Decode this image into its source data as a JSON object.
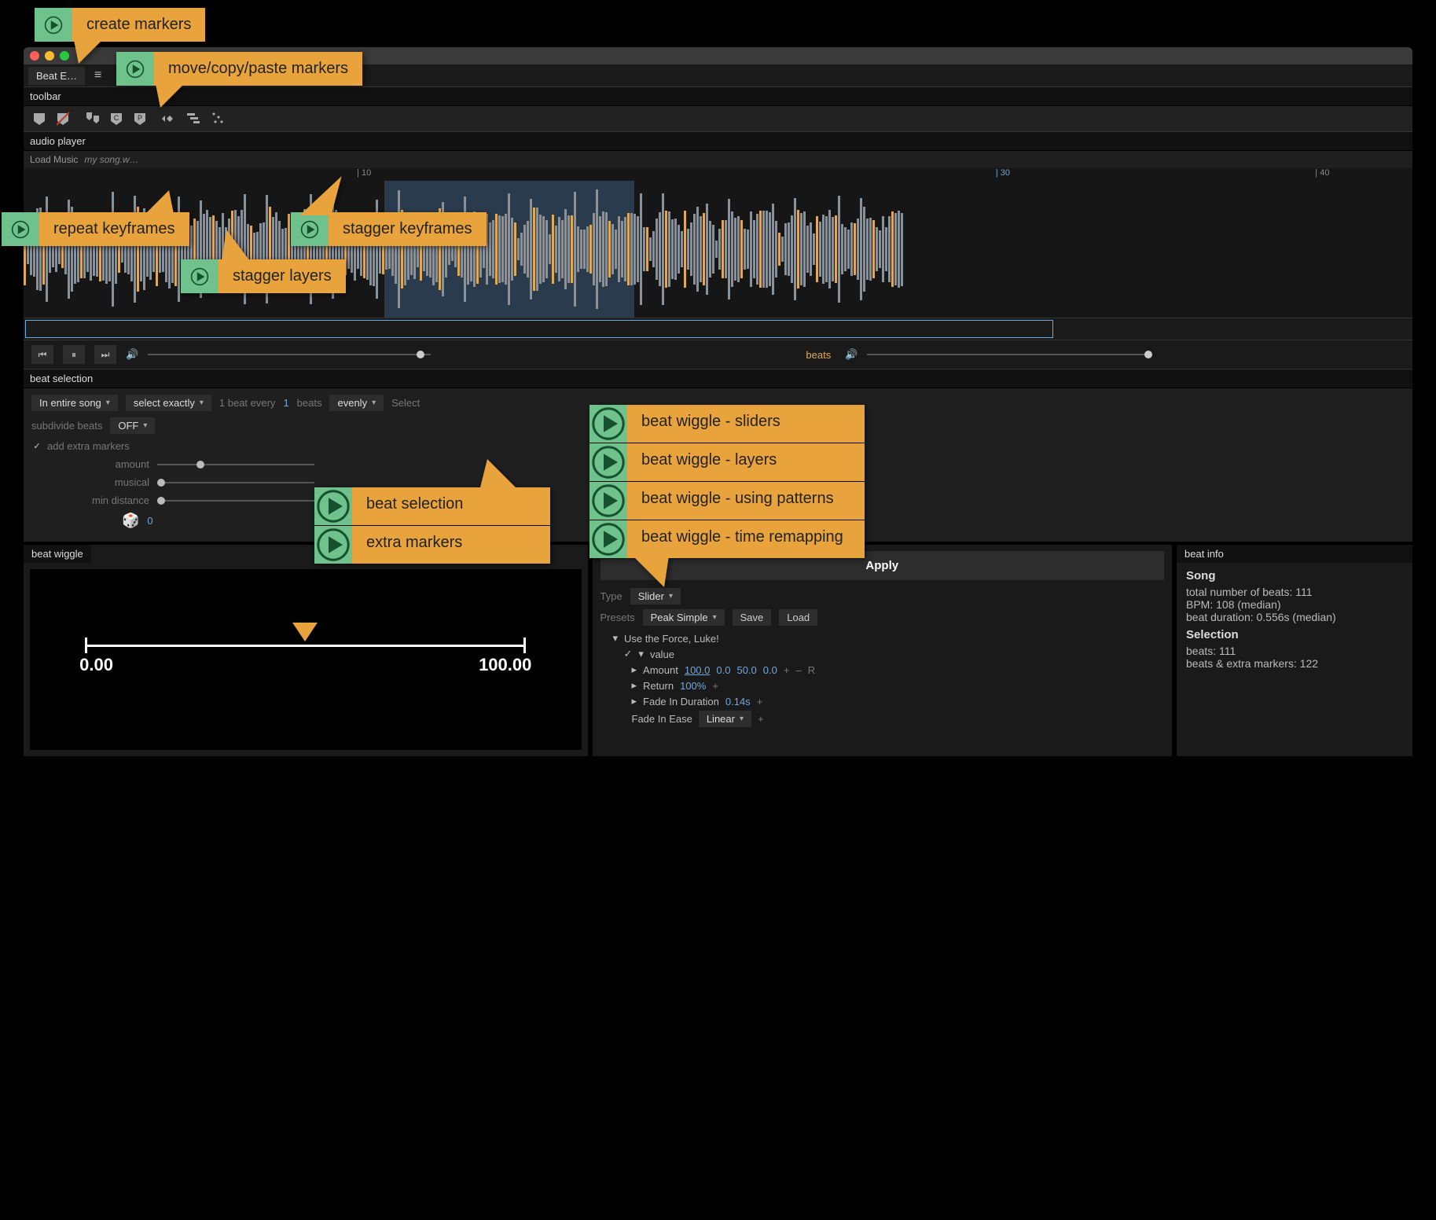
{
  "callouts": {
    "create_markers": "create markers",
    "move_copy_paste": "move/copy/paste markers",
    "repeat_keyframes": "repeat keyframes",
    "stagger_layers": "stagger layers",
    "stagger_keyframes": "stagger keyframes",
    "beat_selection": "beat selection",
    "extra_markers": "extra markers",
    "bw_sliders": "beat wiggle - sliders",
    "bw_layers": "beat wiggle - layers",
    "bw_patterns": "beat wiggle - using patterns",
    "bw_time": "beat wiggle - time remapping"
  },
  "window": {
    "tab_title": "Beat E…"
  },
  "sections": {
    "toolbar": "toolbar",
    "audio_player": "audio player",
    "beat_selection": "beat selection",
    "beat_wiggle": "beat wiggle",
    "beat_info": "beat info"
  },
  "audio": {
    "load_label": "Load Music",
    "filename": "my song.w…",
    "ruler": {
      "t10": "| 10",
      "t30": "| 30",
      "t40": "| 40"
    }
  },
  "transport": {
    "beats_label": "beats"
  },
  "beat_selection": {
    "scope": "In entire song",
    "select_mode": "select exactly",
    "every_prefix": "1 beat every",
    "every_value": "1",
    "every_suffix": "beats",
    "dist": "evenly",
    "select_btn": "Select",
    "subdivide_label": "subdivide beats",
    "subdivide_value": "OFF",
    "add_extra": "add extra markers",
    "amount": "amount",
    "musical": "musical",
    "min_distance": "min distance",
    "random_value": "0"
  },
  "wiggle_preview": {
    "min": "0.00",
    "max": "100.00"
  },
  "apply": {
    "apply_btn": "Apply",
    "type_label": "Type",
    "type_value": "Slider",
    "presets_label": "Presets",
    "preset_value": "Peak Simple",
    "save": "Save",
    "load": "Load",
    "force": "Use the Force, Luke!",
    "value_label": "value",
    "amount_label": "Amount",
    "amount_v1": "100.0",
    "amount_v2": "0.0",
    "amount_v3": "50.0",
    "amount_v4": "0.0",
    "plus": "+",
    "minus": "–",
    "reset": "R",
    "return_label": "Return",
    "return_value": "100%",
    "fadein_label": "Fade In Duration",
    "fadein_value": "0.14s",
    "fadein_ease_label": "Fade In Ease",
    "fadein_ease_value": "Linear"
  },
  "info": {
    "song_h": "Song",
    "total_beats": "total number of beats: 111",
    "bpm": "BPM: 108 (median)",
    "duration": "beat duration: 0.556s (median)",
    "sel_h": "Selection",
    "sel_beats": "beats: 111",
    "sel_extra": "beats & extra markers: 122"
  }
}
